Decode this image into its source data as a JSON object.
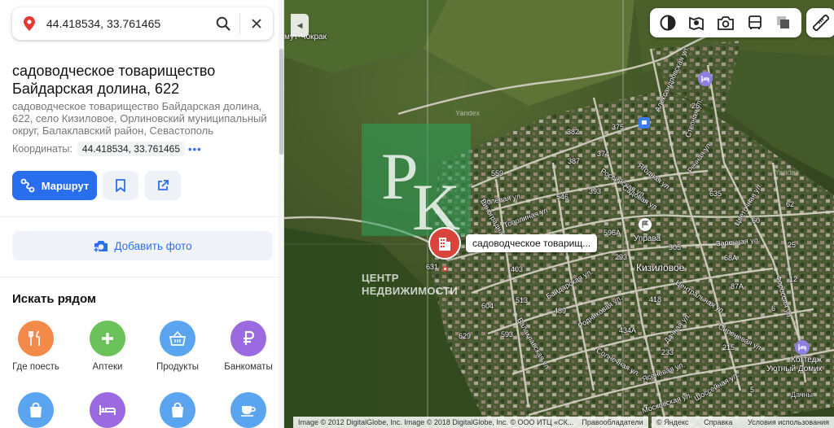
{
  "search": {
    "query": "44.418534, 33.761465",
    "placeholder": ""
  },
  "place": {
    "title": "садоводческое товарищество Байдарская долина, 622",
    "address": "садоводческое товарищество Байдарская долина, 622, село Кизиловое, Орлиновский муниципальный округ, Балаклавский район, Севастополь",
    "coords_label": "Координаты:",
    "coords_value": "44.418534, 33.761465",
    "coords_more": "•••"
  },
  "actions": {
    "route_label": "Маршрут",
    "add_photo_label": "Добавить фото"
  },
  "nearby": {
    "title": "Искать рядом",
    "items": [
      {
        "label": "Где поесть",
        "icon": "fork-knife-icon",
        "color": "#f48a4a"
      },
      {
        "label": "Аптеки",
        "icon": "plus-icon",
        "color": "#6cc25a"
      },
      {
        "label": "Продукты",
        "icon": "basket-icon",
        "color": "#5ba4ef"
      },
      {
        "label": "Банкоматы",
        "icon": "ruble-icon",
        "color": "#9b6ae0"
      },
      {
        "label": "",
        "icon": "shopping-bag-icon",
        "color": "#5ba4ef"
      },
      {
        "label": "",
        "icon": "bed-icon",
        "color": "#9b6ae0"
      },
      {
        "label": "",
        "icon": "shopping-bag-icon",
        "color": "#5ba4ef"
      },
      {
        "label": "",
        "icon": "coffee-cup-icon",
        "color": "#5ba4ef"
      }
    ]
  },
  "map": {
    "tooltip": "садоводческое товарищ...",
    "village": "Кизиловое",
    "poi_admin": "Управа",
    "poi_cottage_line1": "Коттедж",
    "poi_cottage_line2": "Уютный Домик",
    "place_top_left": "мут-Чокрак",
    "area_right": "Дачны",
    "watermark_text_1": "ЦЕНТР",
    "watermark_text_2": "НЕДВИЖИМОСТИ",
    "yandex_wm": "Yandex",
    "streets": [
      "Александровская ул.",
      "Степная ул.",
      "Речная ул.",
      "Полевая ул.",
      "Тополиная ул.",
      "Виноградная ул.",
      "Российская ул.",
      "Ягодная ул.",
      "Садовая ул.",
      "Цветочная ул.",
      "Заречная ул.",
      "Байдарская ул.",
      "Родниковая ул.",
      "Центральная ул.",
      "Дачная ул.",
      "Балаклавская ул.",
      "Солнечная ул.",
      "Ясеневая ул.",
      "Московская ул.",
      "Фороссая ул.",
      "Сиреневая ул.",
      "Шоссейная ул."
    ],
    "numbers": [
      "382",
      "375",
      "374",
      "387",
      "393",
      "559",
      "546",
      "596А",
      "305",
      "293",
      "403",
      "513",
      "418",
      "489",
      "434А",
      "233",
      "604",
      "593",
      "629",
      "631",
      "215",
      "635",
      "60",
      "62",
      "68А",
      "87А",
      "26",
      "25",
      "12",
      "6",
      "5"
    ]
  },
  "footer": {
    "attribution": "Image © 2012 DigitalGlobe, Inc. Image © 2018 DigitalGlobe, Inc. © ООО ИТЦ «СК...",
    "terms": "Правообладатели",
    "yandex": "© Яндекс",
    "help": "Справка",
    "usage": "Условия использования"
  }
}
